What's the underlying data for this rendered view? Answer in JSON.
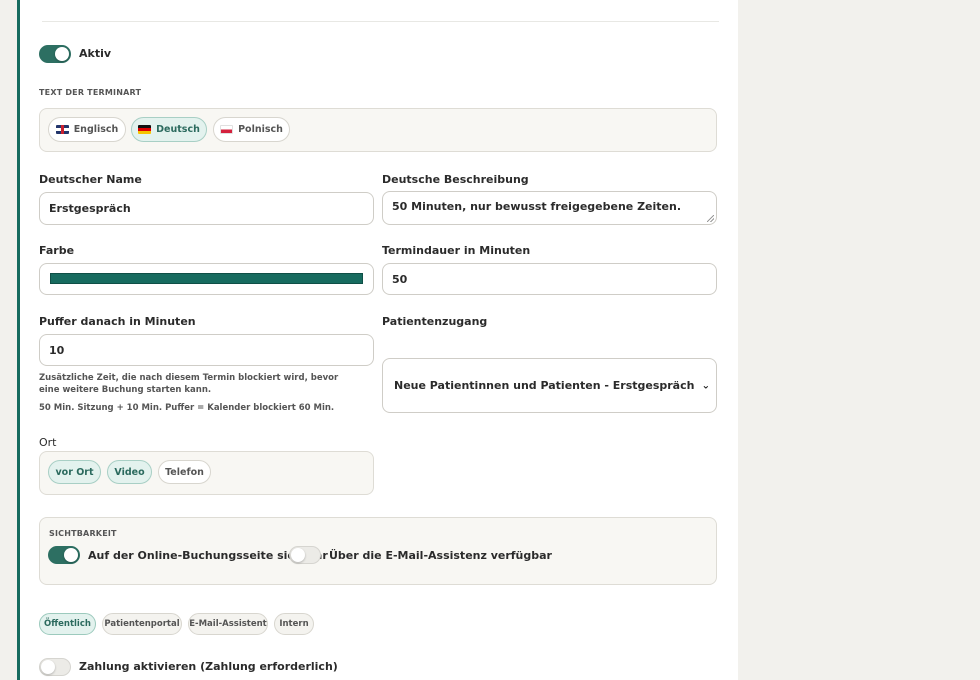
{
  "active_toggle": {
    "label": "Aktiv",
    "on": true
  },
  "text_section": {
    "heading": "TEXT DER TERMINART",
    "languages": [
      {
        "label": "Englisch",
        "flag": "gb-flag-icon",
        "active": false
      },
      {
        "label": "Deutsch",
        "flag": "de-flag-icon",
        "active": true
      },
      {
        "label": "Polnisch",
        "flag": "pl-flag-icon",
        "active": false
      }
    ]
  },
  "fields": {
    "name": {
      "label": "Deutscher Name",
      "value": "Erstgespräch"
    },
    "description": {
      "label": "Deutsche Beschreibung",
      "value": "50 Minuten, nur bewusst freigegebene Zeiten."
    },
    "color": {
      "label": "Farbe",
      "value": "#176b5f"
    },
    "duration": {
      "label": "Termindauer in Minuten",
      "value": "50"
    },
    "buffer": {
      "label": "Puffer danach in Minuten",
      "value": "10",
      "hint": "Zusätzliche Zeit, die nach diesem Termin blockiert wird, bevor eine weitere Buchung starten kann.",
      "summary": "50 Min. Sitzung + 10 Min. Puffer = Kalender blockiert 60 Min."
    },
    "patient_access": {
      "label": "Patientenzugang",
      "value": "Neue Patientinnen und Patienten - Erstgespräch"
    }
  },
  "location": {
    "label": "Ort",
    "options": [
      {
        "label": "vor Ort",
        "active": true
      },
      {
        "label": "Video",
        "active": true
      },
      {
        "label": "Telefon",
        "active": false
      }
    ]
  },
  "visibility": {
    "heading": "SICHTBARKEIT",
    "online_booking": {
      "label": "Auf der Online-Buchungsseite sichtbar",
      "on": true
    },
    "email_assistant": {
      "label": "Über die E-Mail-Assistenz verfügbar",
      "on": false
    }
  },
  "visibility_tags": [
    {
      "label": "Öffentlich",
      "active": true
    },
    {
      "label": "Patientenportal",
      "active": false
    },
    {
      "label": "E-Mail-Assistent",
      "active": false
    },
    {
      "label": "Intern",
      "active": false
    }
  ],
  "payment_toggle": {
    "label": "Zahlung aktivieren (Zahlung erforderlich)",
    "on": false
  },
  "colors": {
    "accent": "#176b5f",
    "toggle_on": "#2d6f62",
    "active_pill_bg": "#e3f2ee"
  }
}
